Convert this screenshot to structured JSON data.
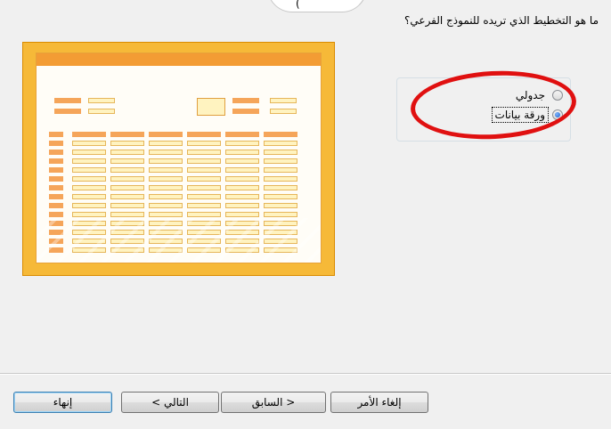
{
  "dialog": {
    "top_tab_label": "(",
    "question": "ما هو التخطيط الذي تريده للنموذج الفرعي؟"
  },
  "layout_options": [
    {
      "label": "جدولي",
      "selected": false
    },
    {
      "label": "ورقة بيانات",
      "selected": true
    }
  ],
  "buttons": {
    "cancel": "إلغاء الأمر",
    "back": "< السابق",
    "next": "التالي >",
    "finish": "إنهاء"
  },
  "colors": {
    "preview_frame": "#f6b938",
    "preview_header": "#f39c34",
    "annotation_circle": "#e01010",
    "default_button_border": "#3c7fb1"
  }
}
